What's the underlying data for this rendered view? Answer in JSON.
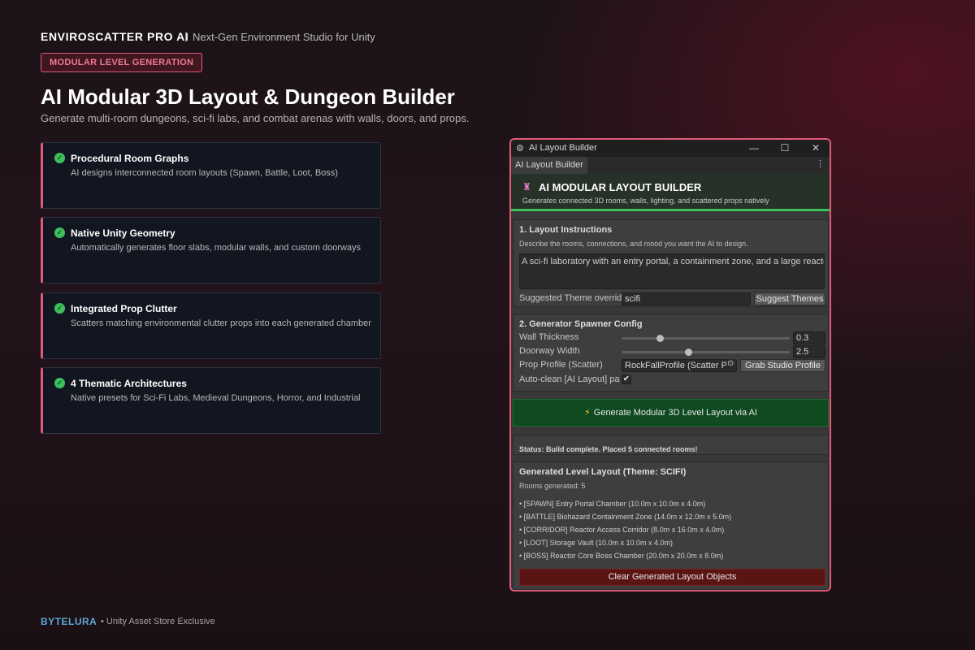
{
  "header": {
    "brand": "ENVIROSCATTER PRO AI",
    "separator": "|",
    "tagline": "Next-Gen Environment Studio for Unity",
    "badge": "MODULAR LEVEL GENERATION",
    "title": "AI Modular 3D Layout & Dungeon Builder",
    "subtitle": "Generate multi-room dungeons, sci-fi labs, and combat arenas with walls, doors, and props."
  },
  "features": [
    {
      "title": "Procedural Room Graphs",
      "desc": "AI designs interconnected room layouts (Spawn, Battle, Loot, Boss)"
    },
    {
      "title": "Native Unity Geometry",
      "desc": "Automatically generates floor slabs, modular walls, and custom doorways"
    },
    {
      "title": "Integrated Prop Clutter",
      "desc": "Scatters matching environmental clutter props into each generated chamber"
    },
    {
      "title": "4 Thematic Architectures",
      "desc": "Native presets for Sci-Fi Labs, Medieval Dungeons, Horror, and Industrial"
    }
  ],
  "icons": {
    "check": "check-circle-icon",
    "window": "unity-editor-icon",
    "panel": "castle-icon",
    "bolt": "bolt-icon",
    "object_picker": "target-icon"
  },
  "colors": {
    "accent": "#e05a78",
    "success": "#3cc15c",
    "generate": "#0f4a20",
    "danger": "#5a1414",
    "footer_brand": "#5fa8d8"
  },
  "window": {
    "title": "AI Layout Builder",
    "minimize": "—",
    "maximize": "☐",
    "close": "✕",
    "tab": "AI Layout Builder",
    "tab_menu": "⋮",
    "panel_title": "AI MODULAR LAYOUT BUILDER",
    "panel_subtitle": "Generates connected 3D rooms, walls, lighting, and scattered props natively",
    "section1": {
      "title": "1. Layout Instructions",
      "hint": "Describe the rooms, connections, and mood you want the AI to design.",
      "instructions": "A sci-fi laboratory with an entry portal, a containment zone, and a large reactor b",
      "theme_label": "Suggested Theme override",
      "theme_value": "scifi",
      "suggest_button": "Suggest Themes"
    },
    "section2": {
      "title": "2. Generator Spawner Config",
      "wall_label": "Wall Thickness",
      "wall_value": "0.3",
      "wall_fraction": 0.23,
      "doorway_label": "Doorway Width",
      "doorway_value": "2.5",
      "doorway_fraction": 0.4,
      "prop_label": "Prop Profile (Scatter)",
      "prop_value": "RockFallProfile (Scatter P",
      "grab_button": "Grab Studio Profile",
      "autoclean_label": "Auto-clean [AI Layout] parent",
      "autoclean_checked": "✔"
    },
    "generate_button": "Generate Modular 3D Level Layout via AI",
    "generate_icon": "⚡",
    "status": "Status: Build complete. Placed 5 connected rooms!",
    "results": {
      "title": "Generated Level Layout (Theme: SCIFI)",
      "count": "Rooms generated: 5",
      "rooms": [
        "• [SPAWN] Entry Portal Chamber (10.0m x 10.0m x 4.0m)",
        "• [BATTLE] Biohazard Containment Zone (14.0m x 12.0m x 5.0m)",
        "• [CORRIDOR] Reactor Access Corridor (8.0m x 16.0m x 4.0m)",
        "• [LOOT] Storage Vault (10.0m x 10.0m x 4.0m)",
        "• [BOSS] Reactor Core Boss Chamber (20.0m x 20.0m x 8.0m)"
      ],
      "clear_button": "Clear Generated Layout Objects"
    }
  },
  "footer": {
    "brand": "BYTELURA",
    "tagline": "• Unity Asset Store Exclusive"
  }
}
